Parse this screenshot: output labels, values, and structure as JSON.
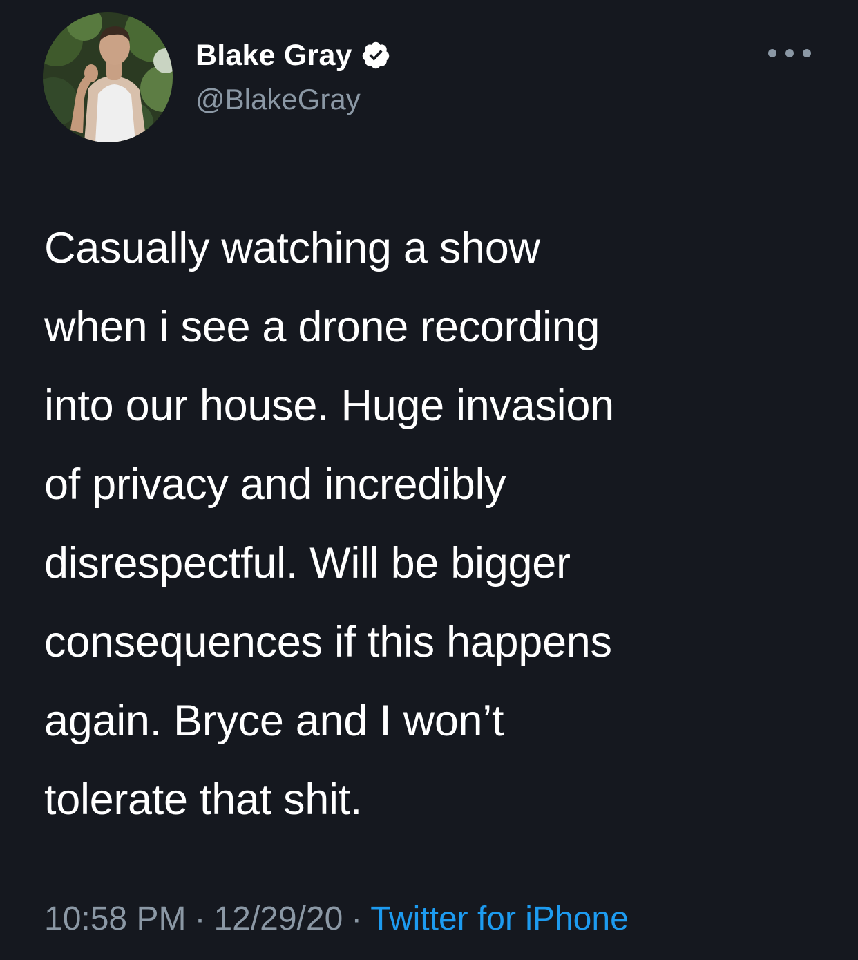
{
  "tweet": {
    "author": {
      "display_name": "Blake Gray",
      "handle": "@BlakeGray",
      "verified": true,
      "avatar_icon": "profile-photo"
    },
    "more_icon": "more-horizontal-icon",
    "text_lines": [
      "Casually watching a show",
      "when i see a drone recording",
      "into our house. Huge invasion",
      "of privacy and incredibly",
      "disrespectful. Will be bigger",
      "consequences if this happens",
      "again. Bryce and I won’t",
      "tolerate that shit."
    ],
    "time": "10:58 PM",
    "date": "12/29/20",
    "separator": "·",
    "source": "Twitter for iPhone"
  },
  "colors": {
    "background": "#15181f",
    "text_primary": "#ffffff",
    "text_secondary": "#8b98a5",
    "link": "#1d9bf0"
  }
}
